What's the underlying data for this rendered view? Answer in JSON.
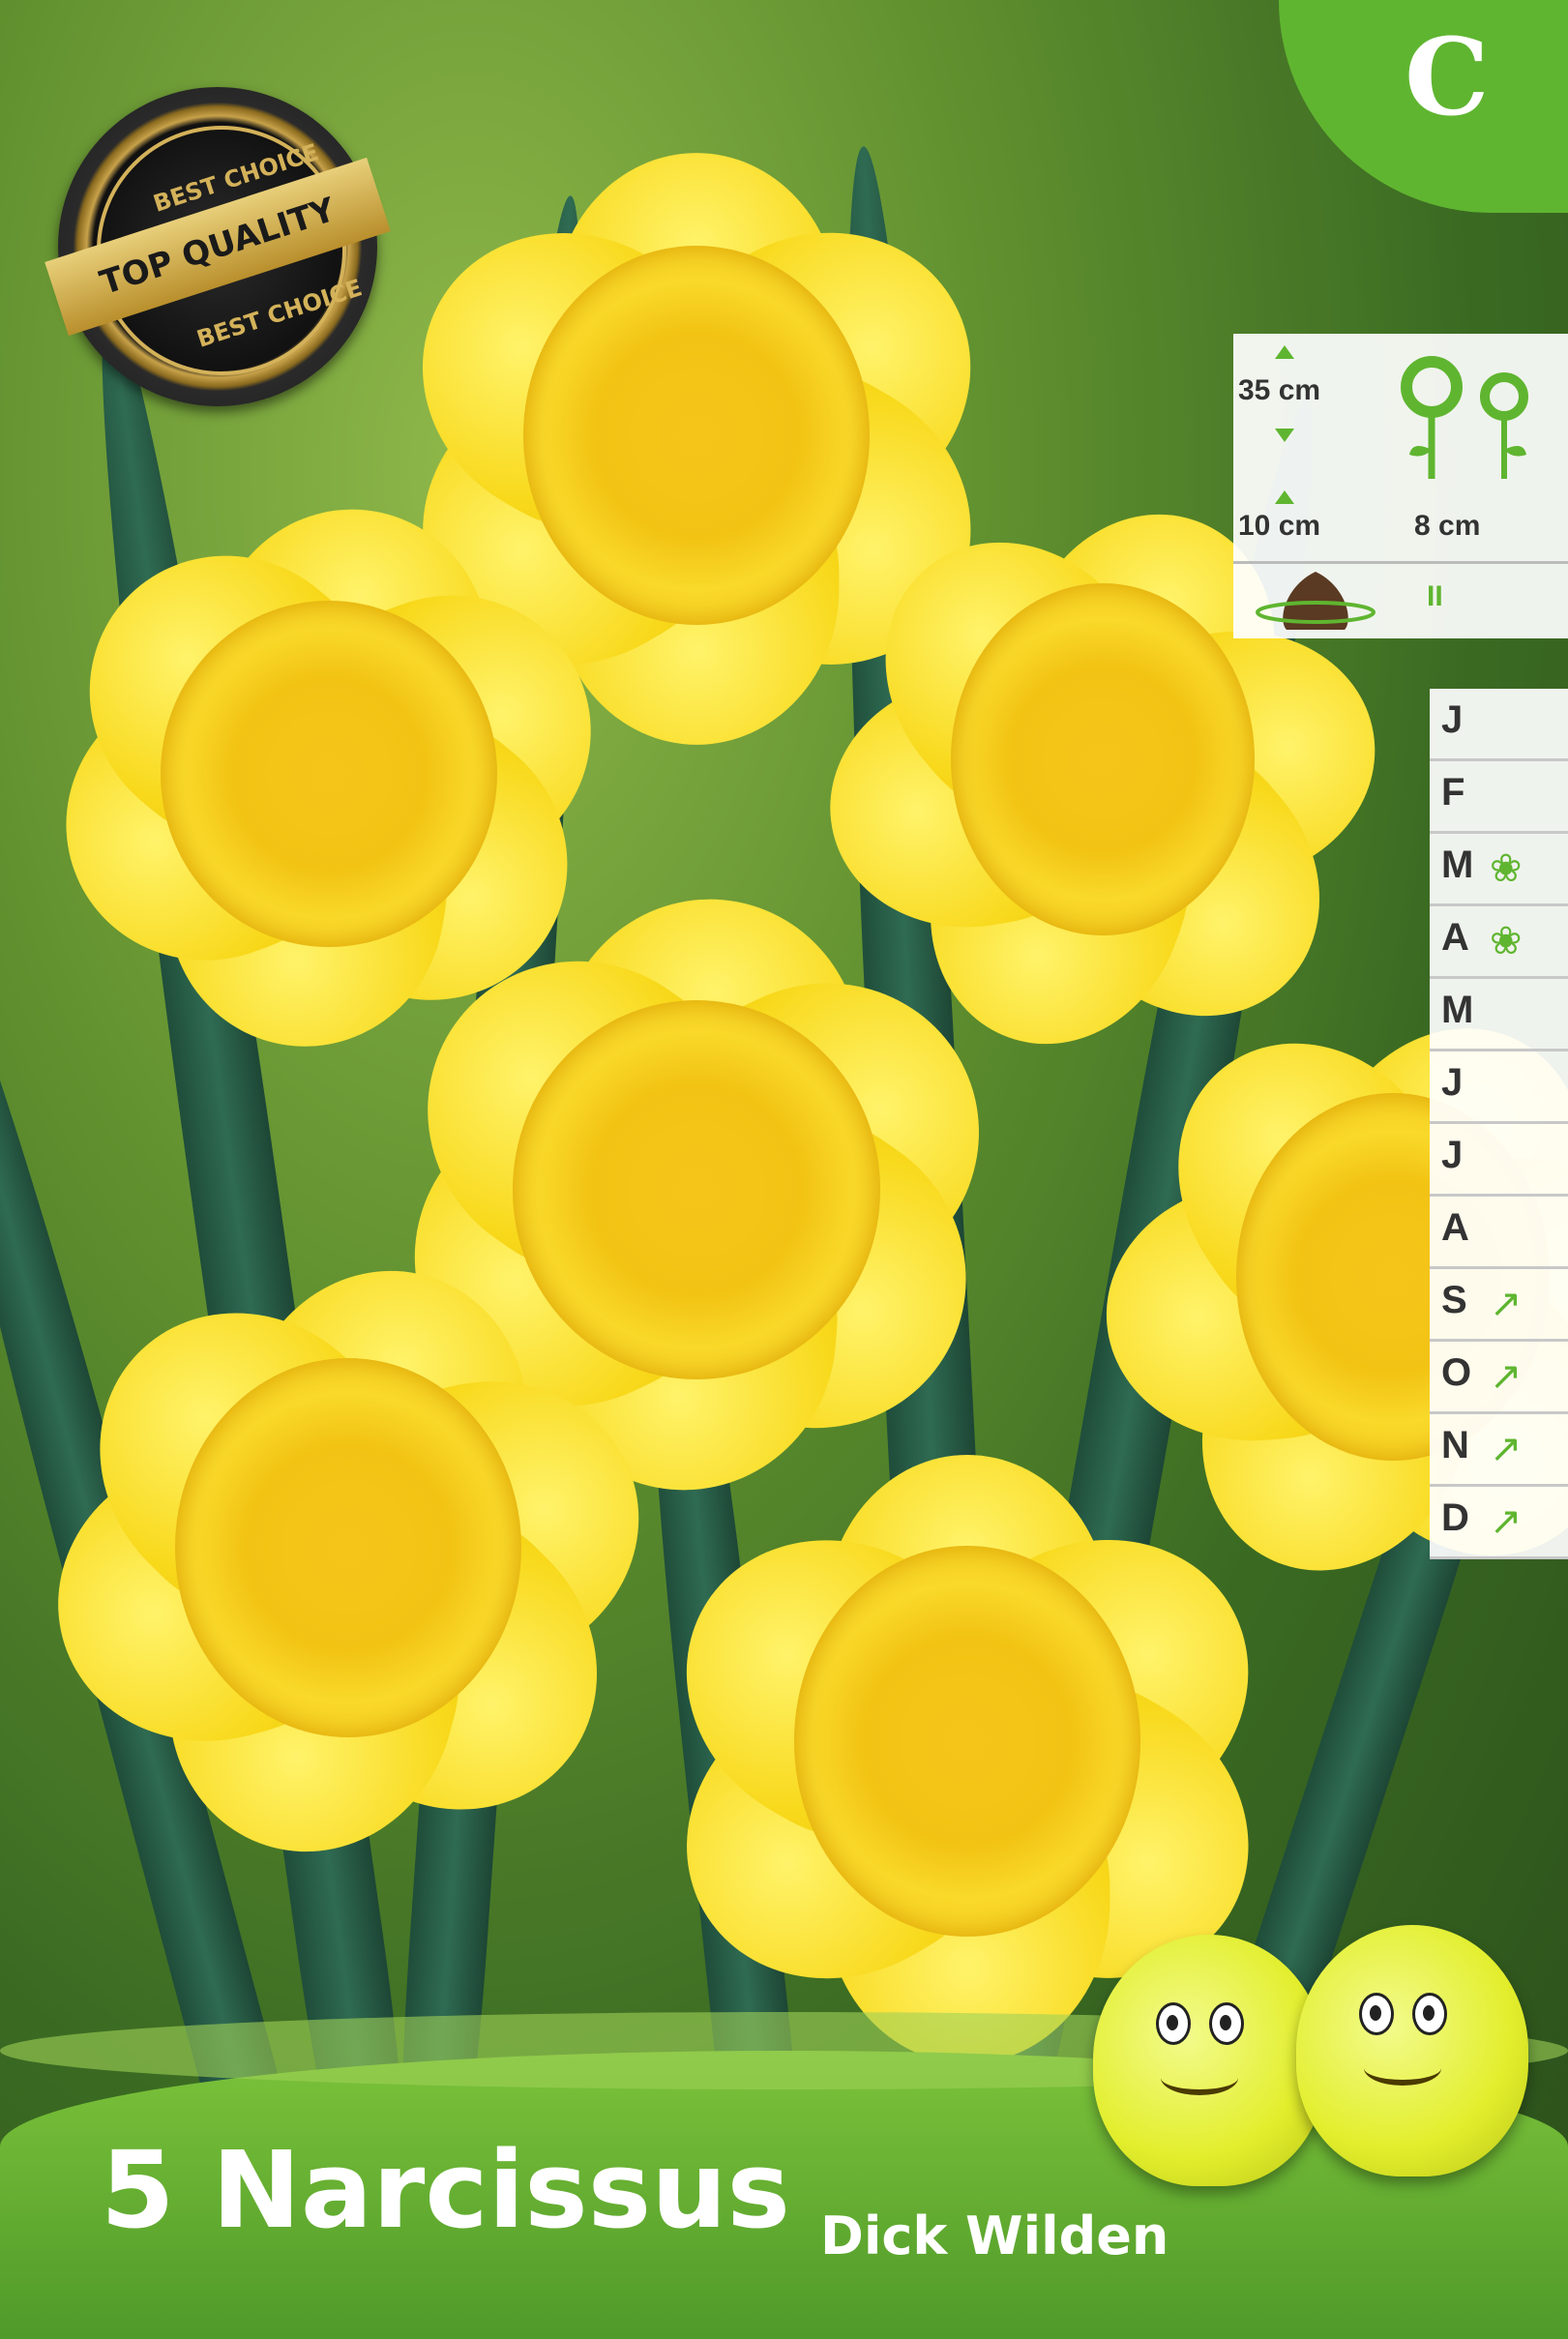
{
  "badge": {
    "letter": "C"
  },
  "seal": {
    "top_text": "BEST CHOICE",
    "band_text": "TOP QUALITY",
    "bottom_text": "BEST CHOICE"
  },
  "planting": {
    "height_label": "35 cm",
    "depth_label": "10 cm",
    "spacing_label": "8 cm",
    "bulb_marker": "II"
  },
  "months": [
    {
      "letter": "J",
      "icon": ""
    },
    {
      "letter": "F",
      "icon": ""
    },
    {
      "letter": "M",
      "icon": "flower-icon"
    },
    {
      "letter": "A",
      "icon": "flower-icon"
    },
    {
      "letter": "M",
      "icon": ""
    },
    {
      "letter": "J",
      "icon": ""
    },
    {
      "letter": "J",
      "icon": ""
    },
    {
      "letter": "A",
      "icon": ""
    },
    {
      "letter": "S",
      "icon": "trowel-icon"
    },
    {
      "letter": "O",
      "icon": "trowel-icon"
    },
    {
      "letter": "N",
      "icon": "trowel-icon"
    },
    {
      "letter": "D",
      "icon": "trowel-icon"
    }
  ],
  "product": {
    "count_name": "5 Narcissus",
    "variety": "Dick Wilden"
  },
  "colors": {
    "accent_green": "#5fb530",
    "flower_yellow": "#f8d81a"
  }
}
